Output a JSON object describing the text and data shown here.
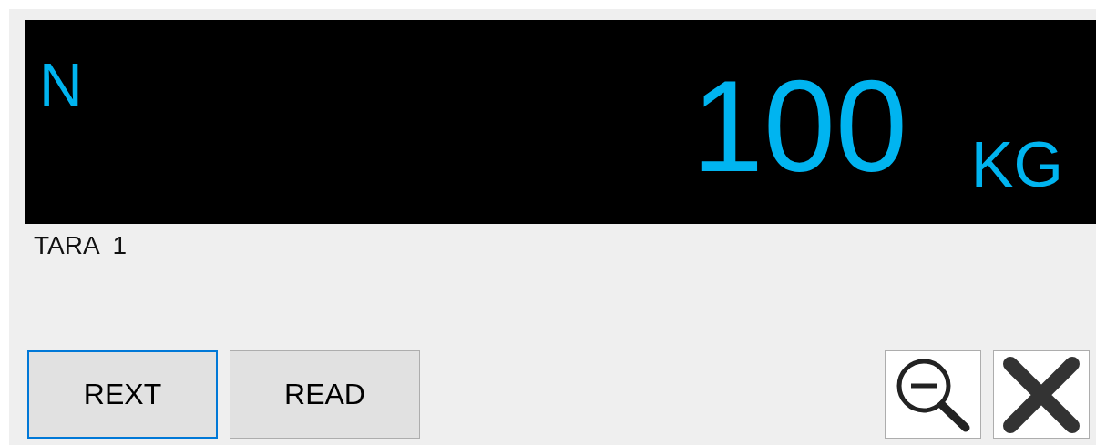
{
  "display": {
    "mode": "N",
    "value": "100",
    "unit": "KG"
  },
  "tare_label": "TARA  1",
  "buttons": [
    {
      "label": "REXT",
      "focused": true
    },
    {
      "label": "READ",
      "focused": false
    }
  ]
}
